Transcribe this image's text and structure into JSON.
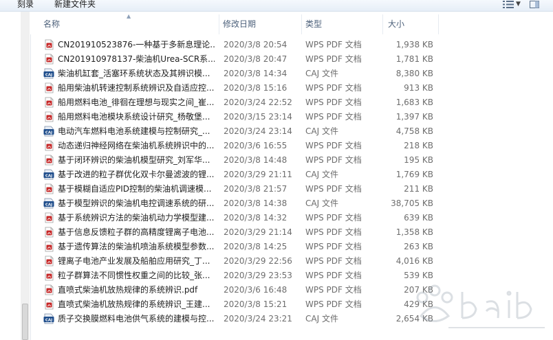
{
  "toolbar": {
    "burn_label": "刻录",
    "new_folder_label": "新建文件夹"
  },
  "columns": {
    "name": "名称",
    "date": "修改日期",
    "type": "类型",
    "size": "大小"
  },
  "files": [
    {
      "icon": "pdf-icon",
      "name": "CN201910523876-一种基于多新息理论...",
      "date": "2020/3/8 20:54",
      "type": "WPS PDF 文档",
      "size": "1,938 KB"
    },
    {
      "icon": "pdf-icon",
      "name": "CN201910978137-柴油机Urea-SCR系...",
      "date": "2020/3/8 20:47",
      "type": "WPS PDF 文档",
      "size": "1,781 KB"
    },
    {
      "icon": "caj-icon",
      "name": "柴油机缸套_活塞环系统状态及其辨识模...",
      "date": "2020/3/8 14:34",
      "type": "CAJ 文件",
      "size": "8,380 KB"
    },
    {
      "icon": "pdf-icon",
      "name": "船用柴油机转速控制系统辨识及自适应控...",
      "date": "2020/3/8 15:16",
      "type": "WPS PDF 文档",
      "size": "913 KB"
    },
    {
      "icon": "pdf-icon",
      "name": "船用燃料电池_徘徊在理想与现实之间_崔...",
      "date": "2020/3/24 22:52",
      "type": "WPS PDF 文档",
      "size": "1,683 KB"
    },
    {
      "icon": "pdf-icon",
      "name": "船用燃料电池模块系统设计研究_杨敬堡...",
      "date": "2020/3/15 23:14",
      "type": "WPS PDF 文档",
      "size": "1,397 KB"
    },
    {
      "icon": "caj-icon",
      "name": "电动汽车燃料电池系统建模与控制研究_...",
      "date": "2020/3/24 23:14",
      "type": "CAJ 文件",
      "size": "4,758 KB"
    },
    {
      "icon": "pdf-icon",
      "name": "动态递归神经网络在柴油机系统辨识中的...",
      "date": "2020/3/6 16:55",
      "type": "WPS PDF 文档",
      "size": "218 KB"
    },
    {
      "icon": "pdf-icon",
      "name": "基于闭环辨识的柴油机模型研究_刘军华...",
      "date": "2020/3/8 14:48",
      "type": "WPS PDF 文档",
      "size": "195 KB"
    },
    {
      "icon": "caj-icon",
      "name": "基于改进的粒子群优化双卡尔曼滤波的锂...",
      "date": "2020/3/29 21:11",
      "type": "CAJ 文件",
      "size": "1,769 KB"
    },
    {
      "icon": "pdf-icon",
      "name": "基于模糊自适应PID控制的柴油机调速模...",
      "date": "2020/3/8 21:57",
      "type": "WPS PDF 文档",
      "size": "211 KB"
    },
    {
      "icon": "caj-icon",
      "name": "基于模型辨识的柴油机电控调速系统的研...",
      "date": "2020/3/8 14:38",
      "type": "CAJ 文件",
      "size": "38,705 KB"
    },
    {
      "icon": "pdf-icon",
      "name": "基于系统辨识方法的柴油机动力学模型建...",
      "date": "2020/3/8 14:32",
      "type": "WPS PDF 文档",
      "size": "639 KB"
    },
    {
      "icon": "pdf-icon",
      "name": "基于信息反馈粒子群的高精度锂离子电池...",
      "date": "2020/3/29 21:14",
      "type": "WPS PDF 文档",
      "size": "1,358 KB"
    },
    {
      "icon": "pdf-icon",
      "name": "基于遗传算法的柴油机喷油系统模型参数...",
      "date": "2020/3/8 14:25",
      "type": "WPS PDF 文档",
      "size": "263 KB"
    },
    {
      "icon": "pdf-icon",
      "name": "锂离子电池产业发展及船舶应用研究_丁...",
      "date": "2020/3/29 22:56",
      "type": "WPS PDF 文档",
      "size": "4,016 KB"
    },
    {
      "icon": "pdf-icon",
      "name": "粒子群算法不同惯性权重之间的比较_张...",
      "date": "2020/3/29 23:53",
      "type": "WPS PDF 文档",
      "size": "539 KB"
    },
    {
      "icon": "pdf-icon",
      "name": "直喷式柴油机放热规律的系统辨识.pdf",
      "date": "2020/3/6 16:48",
      "type": "WPS PDF 文档",
      "size": "207 KB"
    },
    {
      "icon": "pdf-icon",
      "name": "直喷式柴油机放热规律的系统辨识_王建...",
      "date": "2020/3/8 15:21",
      "type": "WPS PDF 文档",
      "size": "429 KB"
    },
    {
      "icon": "caj-icon",
      "name": "质子交换膜燃料电池供气系统的建模与控...",
      "date": "2020/3/24 23:21",
      "type": "CAJ 文件",
      "size": "2,654 KB"
    }
  ],
  "colors": {
    "pdf_icon": "#c62828",
    "caj_icon": "#1f4e8c",
    "header_text": "#4c607a",
    "secondary_text": "#6d6d6d"
  }
}
